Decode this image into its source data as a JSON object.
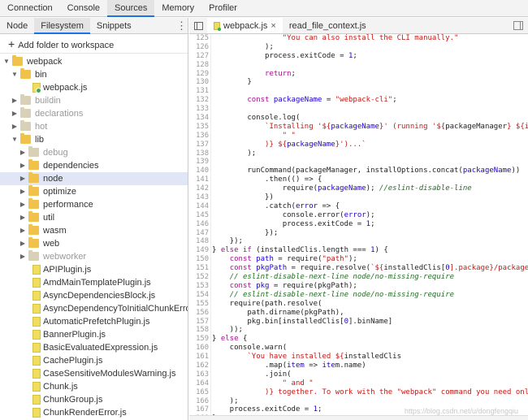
{
  "top_tabs": [
    "Connection",
    "Console",
    "Sources",
    "Memory",
    "Profiler"
  ],
  "navigator": {
    "tabs": [
      "Node",
      "Filesystem",
      "Snippets"
    ],
    "add_folder": "Add folder to workspace",
    "tree": [
      {
        "label": "webpack",
        "type": "folder",
        "depth": 0,
        "open": true
      },
      {
        "label": "bin",
        "type": "folder",
        "depth": 1,
        "open": true
      },
      {
        "label": "webpack.js",
        "type": "file",
        "depth": 2
      },
      {
        "label": "buildin",
        "type": "folder",
        "depth": 1,
        "dim": true
      },
      {
        "label": "declarations",
        "type": "folder",
        "depth": 1,
        "dim": true
      },
      {
        "label": "hot",
        "type": "folder",
        "depth": 1,
        "dim": true
      },
      {
        "label": "lib",
        "type": "folder",
        "depth": 1,
        "open": true
      },
      {
        "label": "debug",
        "type": "folder",
        "depth": 2,
        "dim": true
      },
      {
        "label": "dependencies",
        "type": "folder",
        "depth": 2
      },
      {
        "label": "node",
        "type": "folder",
        "depth": 2,
        "selected": true
      },
      {
        "label": "optimize",
        "type": "folder",
        "depth": 2
      },
      {
        "label": "performance",
        "type": "folder",
        "depth": 2
      },
      {
        "label": "util",
        "type": "folder",
        "depth": 2
      },
      {
        "label": "wasm",
        "type": "folder",
        "depth": 2
      },
      {
        "label": "web",
        "type": "folder",
        "depth": 2
      },
      {
        "label": "webworker",
        "type": "folder",
        "depth": 2,
        "dim": true
      },
      {
        "label": "APIPlugin.js",
        "type": "file",
        "depth": 2
      },
      {
        "label": "AmdMainTemplatePlugin.js",
        "type": "file",
        "depth": 2
      },
      {
        "label": "AsyncDependenciesBlock.js",
        "type": "file",
        "depth": 2
      },
      {
        "label": "AsyncDependencyToInitialChunkError.js",
        "type": "file",
        "depth": 2
      },
      {
        "label": "AutomaticPrefetchPlugin.js",
        "type": "file",
        "depth": 2
      },
      {
        "label": "BannerPlugin.js",
        "type": "file",
        "depth": 2
      },
      {
        "label": "BasicEvaluatedExpression.js",
        "type": "file",
        "depth": 2
      },
      {
        "label": "CachePlugin.js",
        "type": "file",
        "depth": 2
      },
      {
        "label": "CaseSensitiveModulesWarning.js",
        "type": "file",
        "depth": 2
      },
      {
        "label": "Chunk.js",
        "type": "file",
        "depth": 2
      },
      {
        "label": "ChunkGroup.js",
        "type": "file",
        "depth": 2
      },
      {
        "label": "ChunkRenderError.js",
        "type": "file",
        "depth": 2
      }
    ]
  },
  "editor": {
    "tabs": [
      {
        "label": "webpack.js",
        "active": true,
        "closable": true
      },
      {
        "label": "read_file_context.js",
        "active": false
      }
    ],
    "first_line": 125,
    "lines": [
      [
        [
          "                \"You can also install the CLI manually.\"",
          "str"
        ]
      ],
      [
        [
          "            );",
          ""
        ]
      ],
      [
        [
          "            process.exitCode = ",
          ""
        ],
        [
          "1",
          "var"
        ],
        [
          ";",
          ""
        ]
      ],
      [
        [
          "",
          ""
        ]
      ],
      [
        [
          "            ",
          ""
        ],
        [
          "return",
          "kw"
        ],
        [
          ";",
          ""
        ]
      ],
      [
        [
          "        }",
          ""
        ]
      ],
      [
        [
          "",
          ""
        ]
      ],
      [
        [
          "        ",
          ""
        ],
        [
          "const",
          "kw"
        ],
        [
          " ",
          ""
        ],
        [
          "packageName",
          "var"
        ],
        [
          " = ",
          ""
        ],
        [
          "\"webpack-cli\"",
          "str"
        ],
        [
          ";",
          ""
        ]
      ],
      [
        [
          "",
          ""
        ]
      ],
      [
        [
          "        console.log(",
          ""
        ]
      ],
      [
        [
          "            ",
          ""
        ],
        [
          "`Installing '${",
          "str"
        ],
        [
          "packageName",
          "var"
        ],
        [
          "}' (running '${",
          "str"
        ],
        [
          "packageManager",
          ""
        ],
        [
          "} ${in",
          "str"
        ]
      ],
      [
        [
          "                ",
          ""
        ],
        [
          "\" \"",
          "str"
        ]
      ],
      [
        [
          "            ",
          ""
        ],
        [
          ")} ${",
          "str"
        ],
        [
          "packageName",
          "var"
        ],
        [
          "}')...`",
          "str"
        ]
      ],
      [
        [
          "        );",
          ""
        ]
      ],
      [
        [
          "",
          ""
        ]
      ],
      [
        [
          "        runCommand(packageManager, installOptions.concat(",
          ""
        ],
        [
          "packageName",
          "var"
        ],
        [
          "))",
          ""
        ]
      ],
      [
        [
          "            .then(() => {",
          ""
        ]
      ],
      [
        [
          "                require(",
          ""
        ],
        [
          "packageName",
          "var"
        ],
        [
          "); ",
          ""
        ],
        [
          "//eslint-disable-line",
          "cmt"
        ]
      ],
      [
        [
          "            })",
          ""
        ]
      ],
      [
        [
          "            .catch(",
          ""
        ],
        [
          "error",
          "var"
        ],
        [
          " => {",
          ""
        ]
      ],
      [
        [
          "                console.error(",
          ""
        ],
        [
          "error",
          "var"
        ],
        [
          ");",
          ""
        ]
      ],
      [
        [
          "                process.exitCode = ",
          ""
        ],
        [
          "1",
          "var"
        ],
        [
          ";",
          ""
        ]
      ],
      [
        [
          "            });",
          ""
        ]
      ],
      [
        [
          "    });",
          ""
        ]
      ],
      [
        [
          "} ",
          ""
        ],
        [
          "else if",
          "kw"
        ],
        [
          " (installedClis.length === ",
          ""
        ],
        [
          "1",
          "var"
        ],
        [
          ") {",
          ""
        ]
      ],
      [
        [
          "    ",
          ""
        ],
        [
          "const",
          "kw"
        ],
        [
          " ",
          ""
        ],
        [
          "path",
          "var"
        ],
        [
          " = require(",
          ""
        ],
        [
          "\"path\"",
          "str"
        ],
        [
          ");",
          ""
        ]
      ],
      [
        [
          "    ",
          ""
        ],
        [
          "const",
          "kw"
        ],
        [
          " ",
          ""
        ],
        [
          "pkgPath",
          "var"
        ],
        [
          " = require.resolve(",
          ""
        ],
        [
          "`${",
          "str"
        ],
        [
          "installedClis[",
          ""
        ],
        [
          "0",
          "var"
        ],
        [
          "].package}/package.",
          "str"
        ]
      ],
      [
        [
          "    ",
          ""
        ],
        [
          "// eslint-disable-next-line node/no-missing-require",
          "cmt"
        ]
      ],
      [
        [
          "    ",
          ""
        ],
        [
          "const",
          "kw"
        ],
        [
          " ",
          ""
        ],
        [
          "pkg",
          "var"
        ],
        [
          " = require(pkgPath);",
          ""
        ]
      ],
      [
        [
          "    ",
          ""
        ],
        [
          "// eslint-disable-next-line node/no-missing-require",
          "cmt"
        ]
      ],
      [
        [
          "    require(path.resolve(",
          ""
        ]
      ],
      [
        [
          "        path.dirname(pkgPath),",
          ""
        ]
      ],
      [
        [
          "        pkg.bin[installedClis[",
          ""
        ],
        [
          "0",
          "var"
        ],
        [
          "].binName]",
          ""
        ]
      ],
      [
        [
          "    ));",
          ""
        ]
      ],
      [
        [
          "} ",
          ""
        ],
        [
          "else",
          "kw"
        ],
        [
          " {",
          ""
        ]
      ],
      [
        [
          "    console.warn(",
          ""
        ]
      ],
      [
        [
          "        ",
          ""
        ],
        [
          "`You have installed ${",
          "str"
        ],
        [
          "installedClis",
          ""
        ]
      ],
      [
        [
          "            .map(",
          ""
        ],
        [
          "item",
          "var"
        ],
        [
          " => ",
          ""
        ],
        [
          "item",
          "var"
        ],
        [
          ".name)",
          ""
        ]
      ],
      [
        [
          "            .join(",
          ""
        ]
      ],
      [
        [
          "                ",
          ""
        ],
        [
          "\" and \"",
          "str"
        ]
      ],
      [
        [
          "            ",
          ""
        ],
        [
          ")} together. To work with the \"webpack\" command you need only",
          "str"
        ]
      ],
      [
        [
          "    );",
          ""
        ]
      ],
      [
        [
          "    process.exitCode = ",
          ""
        ],
        [
          "1",
          "var"
        ],
        [
          ";",
          ""
        ]
      ],
      [
        [
          "}",
          ""
        ]
      ],
      [
        [
          "",
          ""
        ]
      ]
    ]
  },
  "watermark": "https://blog.csdn.net/u/dongfengqiu"
}
